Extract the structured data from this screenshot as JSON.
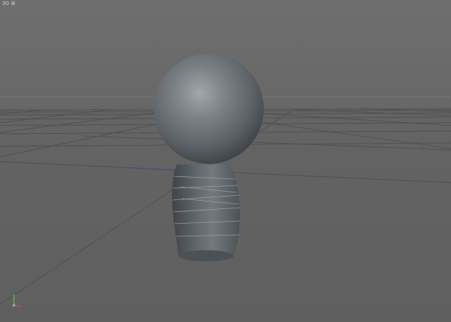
{
  "viewport": {
    "label": "3D 뷰",
    "background": "#646464"
  },
  "scene": {
    "objects": [
      "sphere-head",
      "body-cylinder"
    ],
    "grid": true,
    "axis_gizmo": [
      "x-axis",
      "y-axis",
      "z-axis"
    ]
  }
}
